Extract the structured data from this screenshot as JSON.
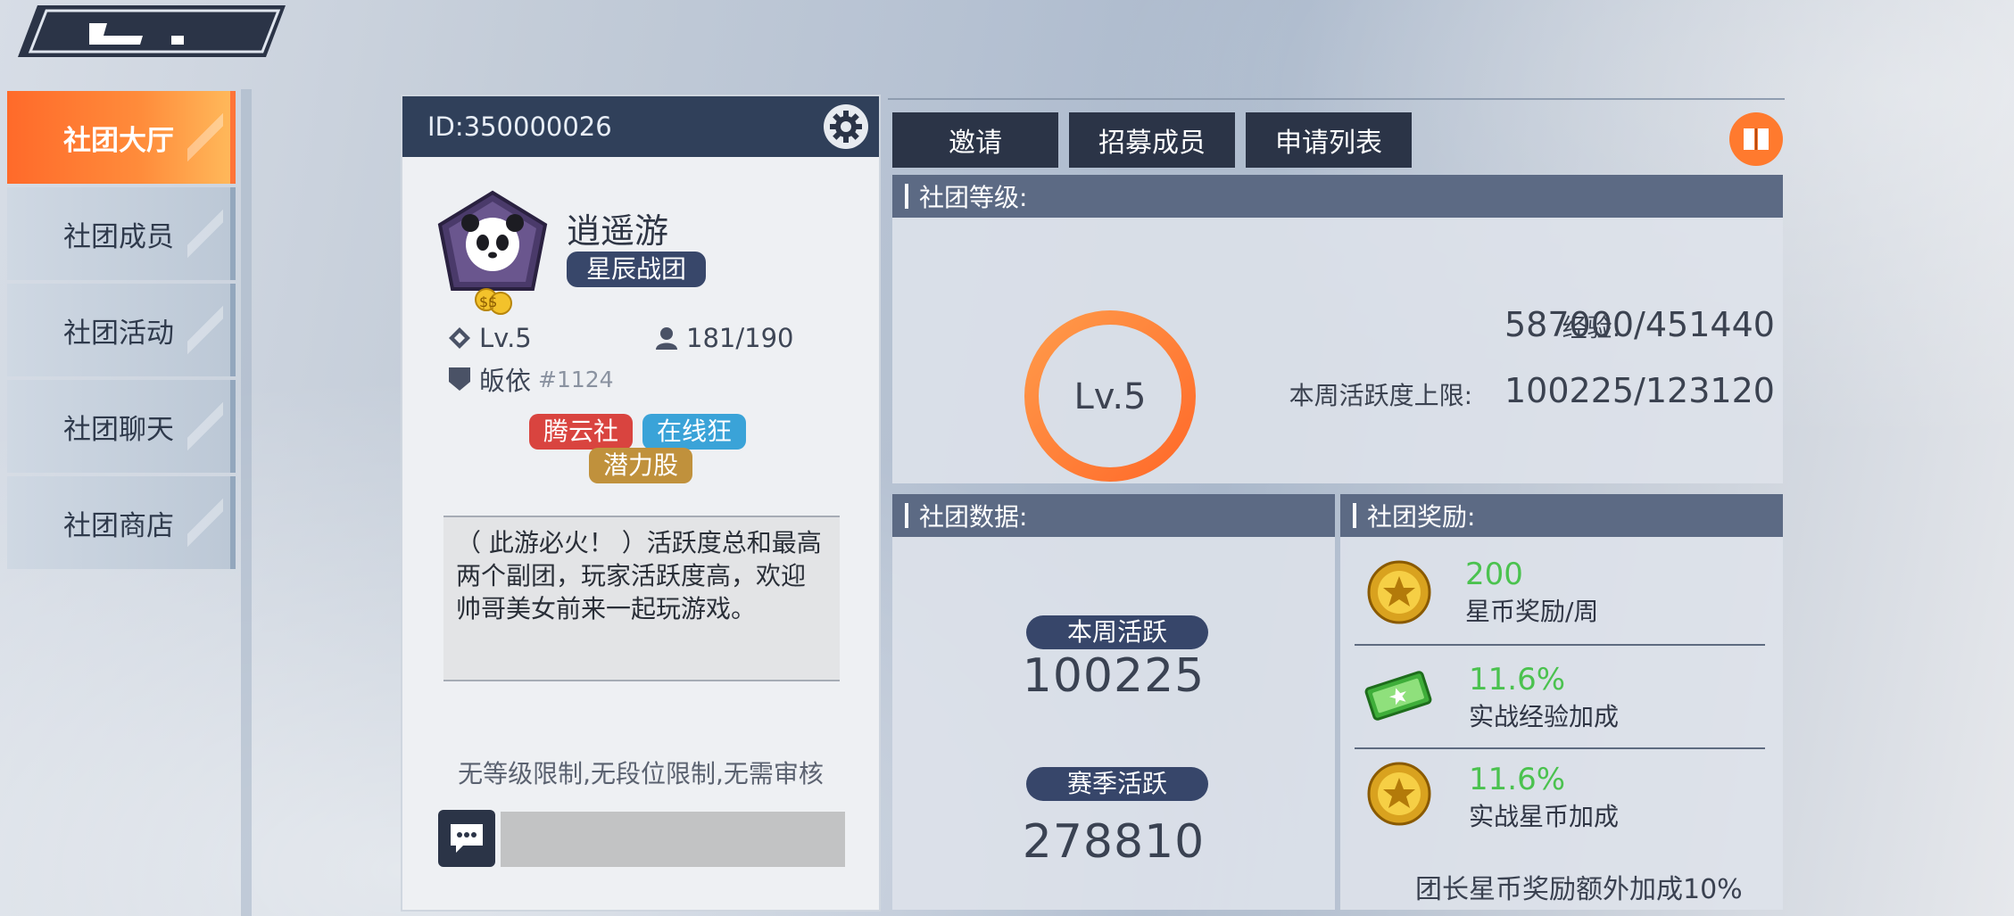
{
  "colors": {
    "accent_orange": "#FF7A2E",
    "navy": "#2B3447",
    "panel_header": "#5C6A84",
    "green_value": "#4BC24F",
    "tag_red": "#D9443F",
    "tag_blue": "#3AA3D8",
    "tag_gold": "#C0913C"
  },
  "sidebar": {
    "items": [
      {
        "label": "社团大厅",
        "active": true
      },
      {
        "label": "社团成员",
        "active": false
      },
      {
        "label": "社团活动",
        "active": false
      },
      {
        "label": "社团聊天",
        "active": false
      },
      {
        "label": "社团商店",
        "active": false
      }
    ]
  },
  "club": {
    "id_text": "ID:350000026",
    "name": "逍遥游",
    "type_badge": "星辰战团",
    "level": "Lv.5",
    "members": "181/190",
    "rank_name": "皈依",
    "rank_number": "#1124",
    "tags": [
      "腾云社",
      "在线狂",
      "潜力股"
    ],
    "description": "（ 此游必火！ ）活跃度总和最高两个副团，玩家活跃度高，欢迎帅哥美女前来一起玩游戏。",
    "limits": "无等级限制,无段位限制,无需审核",
    "icons": {
      "settings": "gear-icon",
      "emblem": "panda-emblem-icon",
      "level": "diamond-icon",
      "members": "person-icon",
      "rank": "shield-icon",
      "chat": "chat-bubble-icon"
    }
  },
  "toolbar": {
    "tabs": [
      "邀请",
      "招募成员",
      "申请列表"
    ],
    "book_icon": "book-icon"
  },
  "level_panel": {
    "title": "社团等级:",
    "ring_label": "Lv.5",
    "exp_label": "经验:",
    "exp_value": "587000/451440",
    "weekly_cap_label": "本周活跃度上限:",
    "weekly_cap_value": "100225/123120"
  },
  "data_panel": {
    "title": "社团数据:",
    "weekly_label": "本周活跃",
    "weekly_value": "100225",
    "season_label": "赛季活跃",
    "season_value": "278810"
  },
  "rewards_panel": {
    "title": "社团奖励:",
    "items": [
      {
        "value": "200",
        "label": "星币奖励/周",
        "icon": "gold-coin-icon"
      },
      {
        "value": "11.6%",
        "label": "实战经验加成",
        "icon": "green-ticket-icon"
      },
      {
        "value": "11.6%",
        "label": "实战星币加成",
        "icon": "gold-coin-icon"
      }
    ],
    "footnote": "团长星币奖励额外加成10%"
  }
}
